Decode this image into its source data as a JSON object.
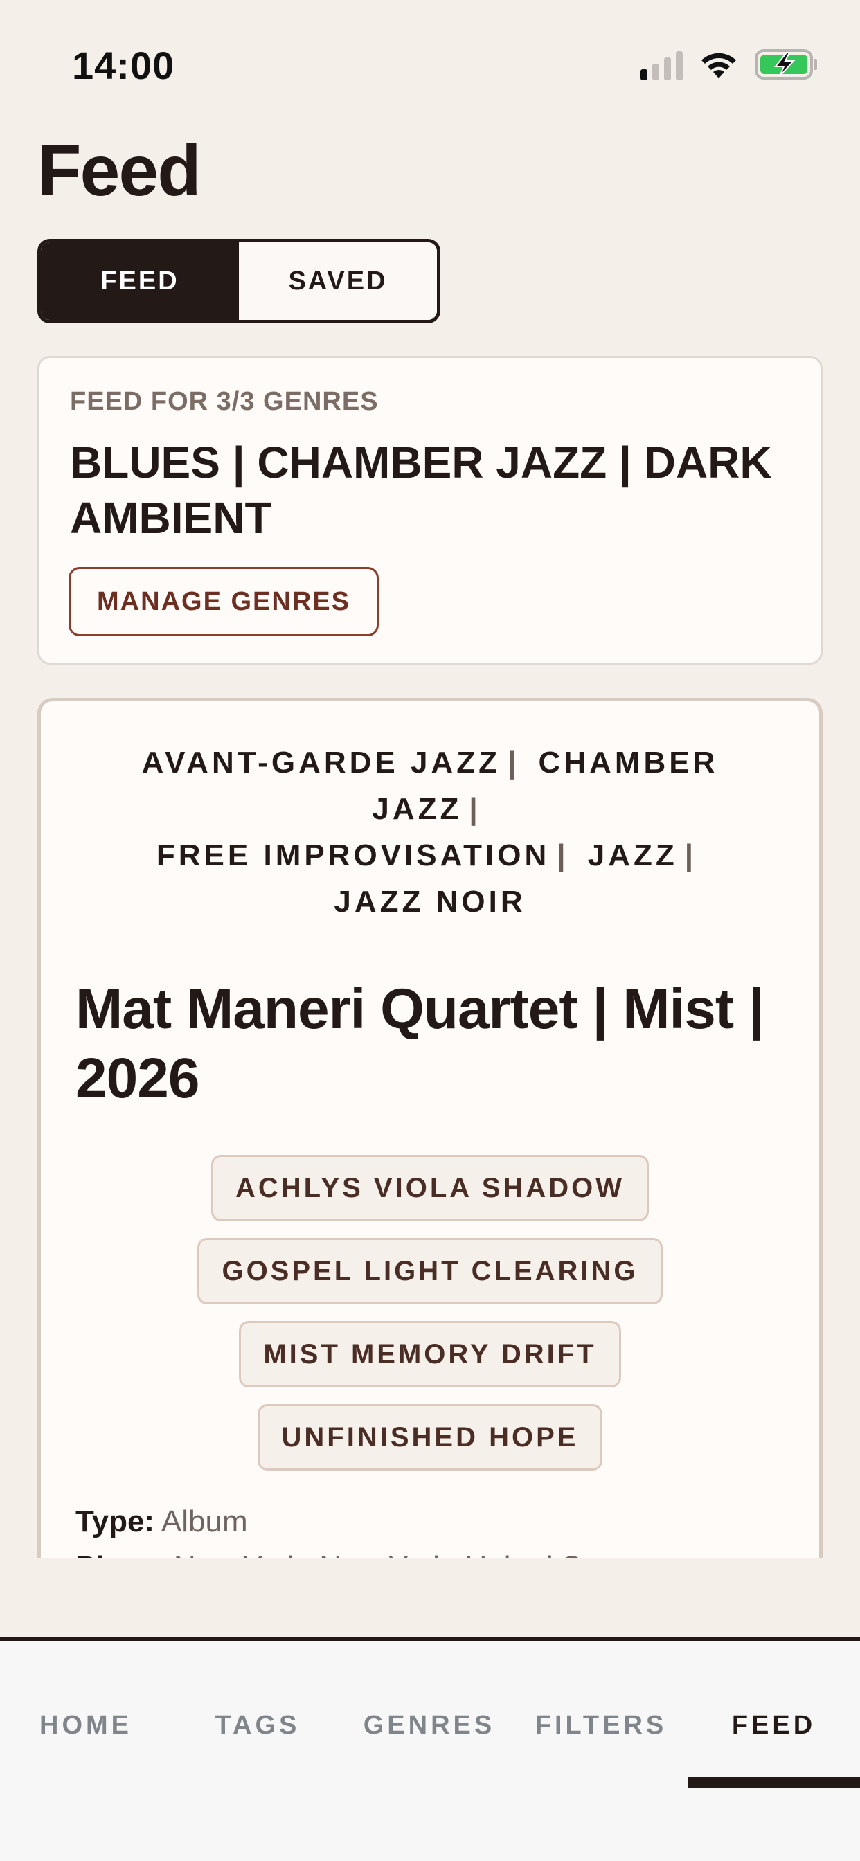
{
  "status_bar": {
    "time": "14:00",
    "icons": [
      "signal-icon",
      "wifi-icon",
      "battery-charging-icon"
    ],
    "battery_color": "#35c759"
  },
  "page": {
    "title": "Feed"
  },
  "segmented": {
    "feed_label": "FEED",
    "saved_label": "SAVED",
    "selected": "FEED"
  },
  "summary": {
    "label": "FEED FOR 3/3 GENRES",
    "genres": "BLUES | CHAMBER JAZZ | DARK AMBIENT",
    "manage_label": "MANAGE GENRES"
  },
  "release": {
    "genres": [
      "AVANT-GARDE JAZZ",
      "CHAMBER JAZZ",
      "FREE IMPROVISATION",
      "JAZZ",
      "JAZZ NOIR"
    ],
    "title": "Mat Maneri Quartet | Mist | 2026",
    "tags": [
      "ACHLYS VIOLA SHADOW",
      "GOSPEL LIGHT CLEARING",
      "MIST MEMORY DRIFT",
      "UNFINISHED HOPE"
    ],
    "type_key": "Type:",
    "type_value": "Album",
    "place_key": "Place:",
    "place_value": "New York, New York, United States"
  },
  "tab_bar": {
    "tabs": [
      {
        "label": "HOME"
      },
      {
        "label": "TAGS"
      },
      {
        "label": "GENRES"
      },
      {
        "label": "FILTERS"
      },
      {
        "label": "FEED"
      }
    ],
    "active": "FEED"
  },
  "colors": {
    "background": "#f5efea",
    "ink": "#231a17",
    "accent_brown": "#6c2f22",
    "tab_inactive": "#7f858b"
  }
}
